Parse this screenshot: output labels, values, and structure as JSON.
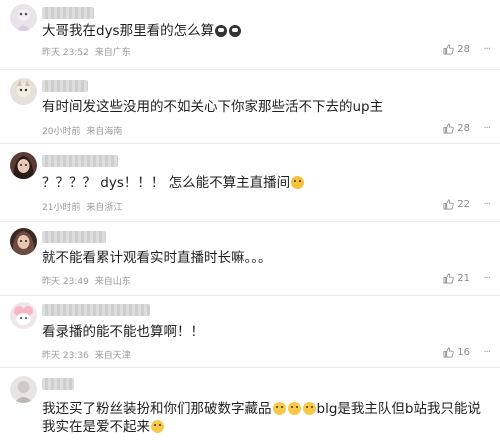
{
  "colors": {
    "meta": "#9a9a9a",
    "text": "#1f1f1f",
    "divider": "#ececec"
  },
  "comments": [
    {
      "text": "大哥我在dys那里看的怎么算",
      "emoji_after": [
        "eyes-emoji",
        "eyes-emoji"
      ],
      "time": "昨天 23:52",
      "location": "来自广东",
      "likes": "28"
    },
    {
      "text": "有时间发这些没用的不如关心下你家那些活不下去的up主",
      "time": "20小时前",
      "location": "来自海南",
      "likes": "28"
    },
    {
      "text": "？？？？ dys！！！ 怎么能不算主直播间",
      "emoji_after": [
        "crying-emoji"
      ],
      "time": "21小时前",
      "location": "来自浙江",
      "likes": "22"
    },
    {
      "text": "就不能看累计观看实时直播时长嘛。。。",
      "time": "昨天 23:49",
      "location": "来自山东",
      "likes": "21"
    },
    {
      "text": "看录播的能不能也算啊！！",
      "time": "昨天 23:36",
      "location": "来自天津",
      "likes": "16"
    },
    {
      "text_part1": "我还买了粉丝装扮和你们那破数字藏品",
      "text_part2": "blg是我主队但b站我只能说",
      "text_part3": "我实在是爱不起来"
    }
  ],
  "icons": {
    "like": "thumbs-up-icon",
    "more": "ellipsis-icon"
  },
  "more_label": "···"
}
